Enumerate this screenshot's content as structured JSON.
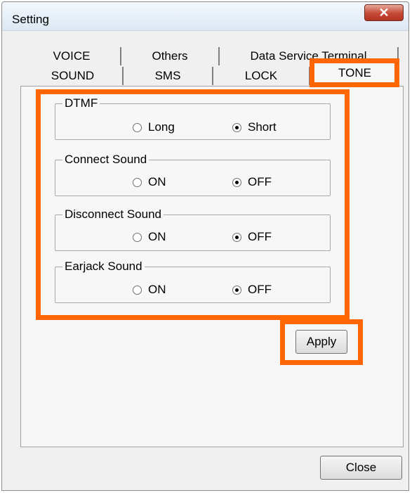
{
  "window": {
    "title": "Setting",
    "close_glyph": "✕"
  },
  "tabs": {
    "row1": [
      "VOICE",
      "Others",
      "Data Service Terminal"
    ],
    "row2": [
      "SOUND",
      "SMS",
      "LOCK",
      "TONE"
    ],
    "active": "TONE"
  },
  "groups": [
    {
      "label": "DTMF",
      "options": [
        "Long",
        "Short"
      ],
      "selected": "Short"
    },
    {
      "label": "Connect Sound",
      "options": [
        "ON",
        "OFF"
      ],
      "selected": "OFF"
    },
    {
      "label": "Disconnect Sound",
      "options": [
        "ON",
        "OFF"
      ],
      "selected": "OFF"
    },
    {
      "label": "Earjack Sound",
      "options": [
        "ON",
        "OFF"
      ],
      "selected": "OFF"
    }
  ],
  "buttons": {
    "apply": "Apply",
    "close": "Close"
  },
  "highlight_color": "#ff6600"
}
